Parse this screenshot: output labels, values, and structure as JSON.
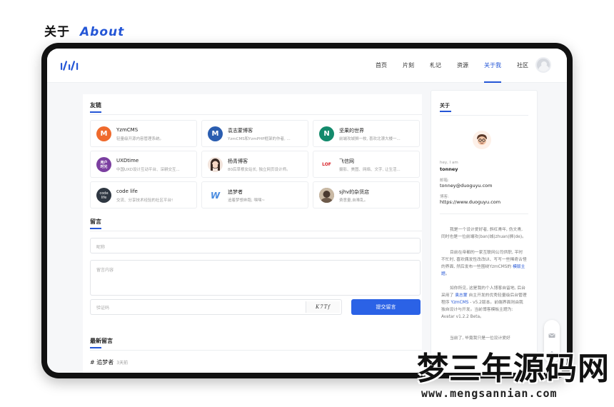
{
  "heading": {
    "cn": "关于",
    "en": "About"
  },
  "nav": {
    "items": [
      {
        "label": "首页"
      },
      {
        "label": "片刻"
      },
      {
        "label": "札记"
      },
      {
        "label": "资源"
      },
      {
        "label": "关于我"
      },
      {
        "label": "社区"
      }
    ],
    "active_index": 4
  },
  "links_section": {
    "title": "友链",
    "items": [
      {
        "name": "YzmCMS",
        "desc": "轻量级开源内容管理系统。",
        "logo_text": "M",
        "color": "#ef6a2d"
      },
      {
        "name": "袁志蒙博客",
        "desc": "YzmCMS和YzmPHP框架的作者, ...",
        "logo_text": "M",
        "color": "#2a5db0"
      },
      {
        "name": "坚果的世界",
        "desc": "前端攻城狮一枚, 喜欢北漂大楼一...",
        "logo_text": "N",
        "color": "#138a6c"
      },
      {
        "name": "UXDtime",
        "desc": "中国UXD设计互动平台、深耕交互...",
        "logo_text": "用户\n时光",
        "color": "#7b3fa0"
      },
      {
        "name": "杨青博客",
        "desc": "80后草根女站长, 独立网页设计师。",
        "logo_text": "",
        "color": "#f2e4dc"
      },
      {
        "name": "飞信网",
        "desc": "摄影、美图、网络、文字, 让生活...",
        "logo_text": "LOF",
        "color": "#ffffff"
      },
      {
        "name": "code life",
        "desc": "交流、分享技术经验的社区平台!",
        "logo_text": "code\nlife",
        "color": "#2f3742"
      },
      {
        "name": "追梦者",
        "desc": "追着梦想奔跑, 嘿嘿~",
        "logo_text": "W",
        "color": "#ffffff"
      },
      {
        "name": "sjhv的杂货店",
        "desc": "费意量,自难乱。",
        "logo_text": "",
        "color": "#8a7b6c"
      }
    ]
  },
  "comment_section": {
    "title": "留言",
    "nickname_placeholder": "昵称",
    "content_placeholder": "留言内容",
    "captcha_placeholder": "验证码",
    "captcha_text": "K7Tf",
    "submit_label": "提交留言"
  },
  "recent_section": {
    "title": "最新留言",
    "item_name": "# 追梦者",
    "item_time": "3天前"
  },
  "sidebar": {
    "title": "关于",
    "greeting": "hey, I am",
    "name": "tonney",
    "email_label": "邮箱:",
    "email": "tonney@duoguyu.com",
    "blog_label": "博客:",
    "blog": "https://www.duoguyu.com",
    "para1": "我是一个设计爱好者, 斜杠青年, 伪文青, 同时也是一位前端攻(ban)城(zhuan)狮(de)。",
    "para2_a": "目前在帝都的一家互联网公司供职, 平时不忙时, 喜欢偶发性改改UI、写写一些稀奇古怪的界面, 然后发布一些围绕YzmCMS的 ",
    "para2_link": "模版主题",
    "para2_b": "。",
    "para3_a": "如你所见, 这是我的个人博客自留地, 后台采用了 ",
    "para3_link1": "袁志蒙",
    "para3_b": " 自主开发的优秀轻量级后台管理程序 ",
    "para3_link2": "YzmCMS",
    "para3_c": " - v5.2版本。前端界面则由我独自设计与开发。当前博客模板主题为: Avatar v1.2.2 Beta。",
    "para4": "当前了, 毕竟我只是一位设计爱好"
  },
  "watermark": {
    "cn": "梦三年源码网",
    "url": "www.mengsannian.com"
  },
  "colors": {
    "accent": "#2456d6",
    "button": "#2b62e6"
  }
}
